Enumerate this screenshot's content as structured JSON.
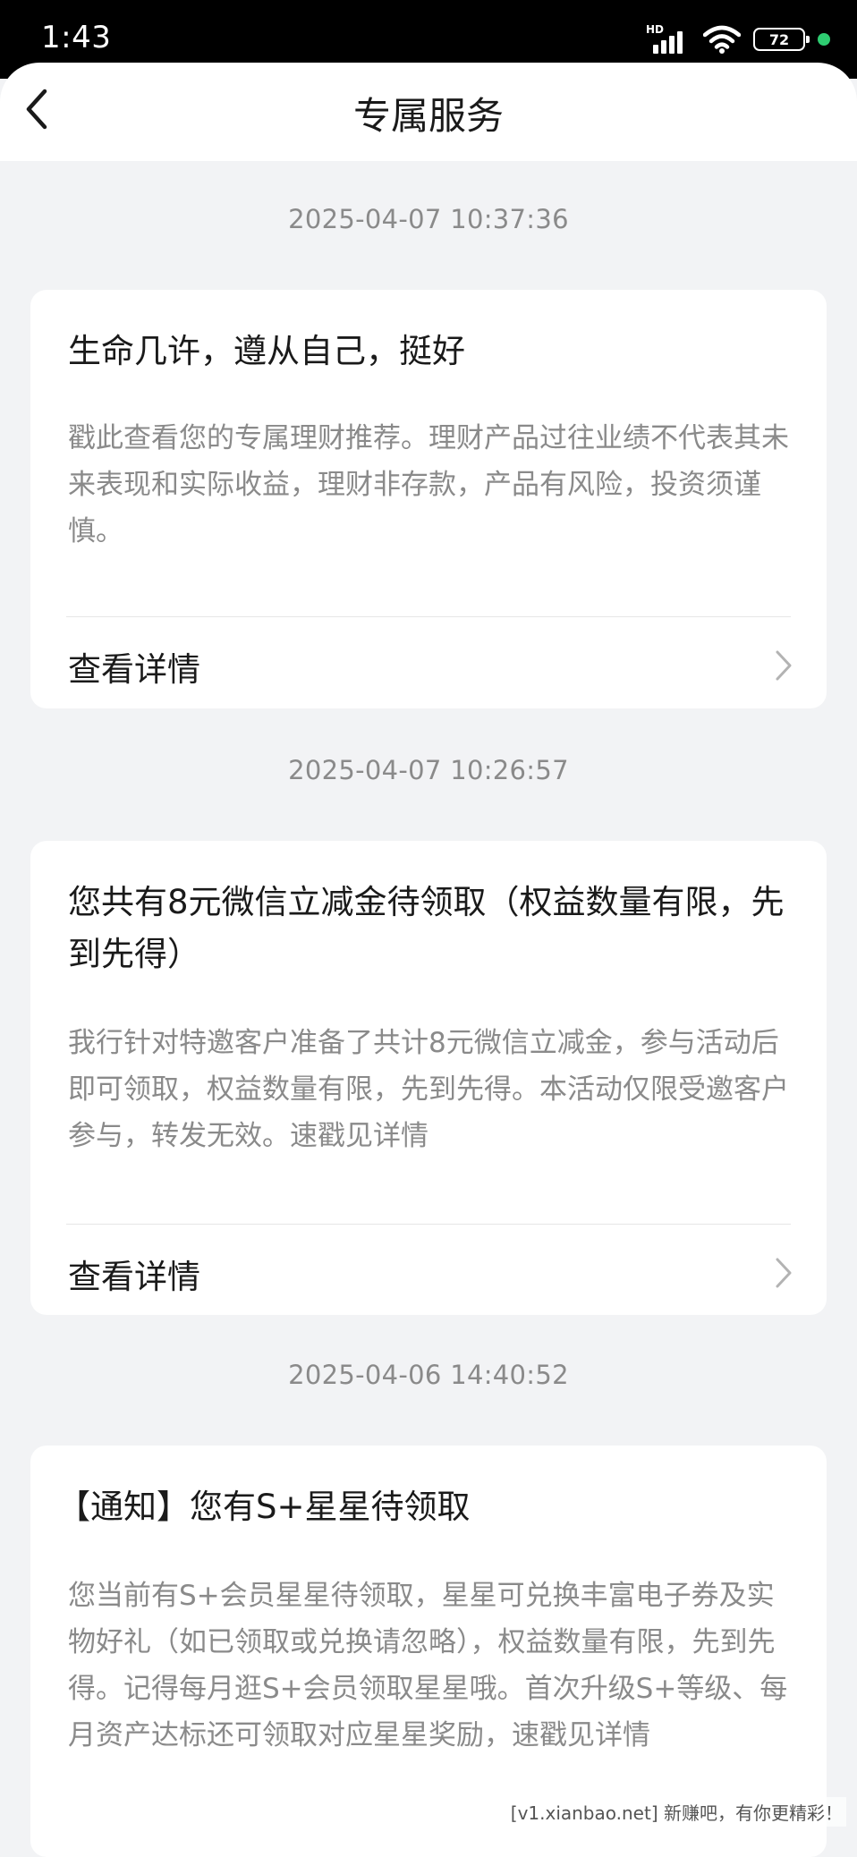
{
  "status_bar": {
    "time": "1:43",
    "hd": "HD",
    "battery": "72",
    "dot_color": "#2ecc71"
  },
  "nav": {
    "title": "专属服务"
  },
  "messages": [
    {
      "timestamp": "2025-04-07 10:37:36",
      "title": "生命几许，遵从自己，挺好",
      "body": "戳此查看您的专属理财推荐。理财产品过往业绩不代表其未来表现和实际收益，理财非存款，产品有风险，投资须谨慎。",
      "action": "查看详情"
    },
    {
      "timestamp": "2025-04-07 10:26:57",
      "title": "您共有8元微信立减金待领取（权益数量有限，先到先得）",
      "body": "我行针对特邀客户准备了共计8元微信立减金，参与活动后即可领取，权益数量有限，先到先得。本活动仅限受邀客户参与，转发无效。速戳见详情",
      "action": "查看详情"
    },
    {
      "timestamp": "2025-04-06 14:40:52",
      "title": "【通知】您有S+星星待领取",
      "body": "您当前有S+会员星星待领取，星星可兑换丰富电子券及实物好礼（如已领取或兑换请忽略），权益数量有限，先到先得。记得每月逛S+会员领取星星哦。首次升级S+等级、每月资产达标还可领取对应星星奖励，速戳见详情"
    }
  ],
  "watermark": "[v1.xianbao.net] 新赚吧，有你更精彩！"
}
